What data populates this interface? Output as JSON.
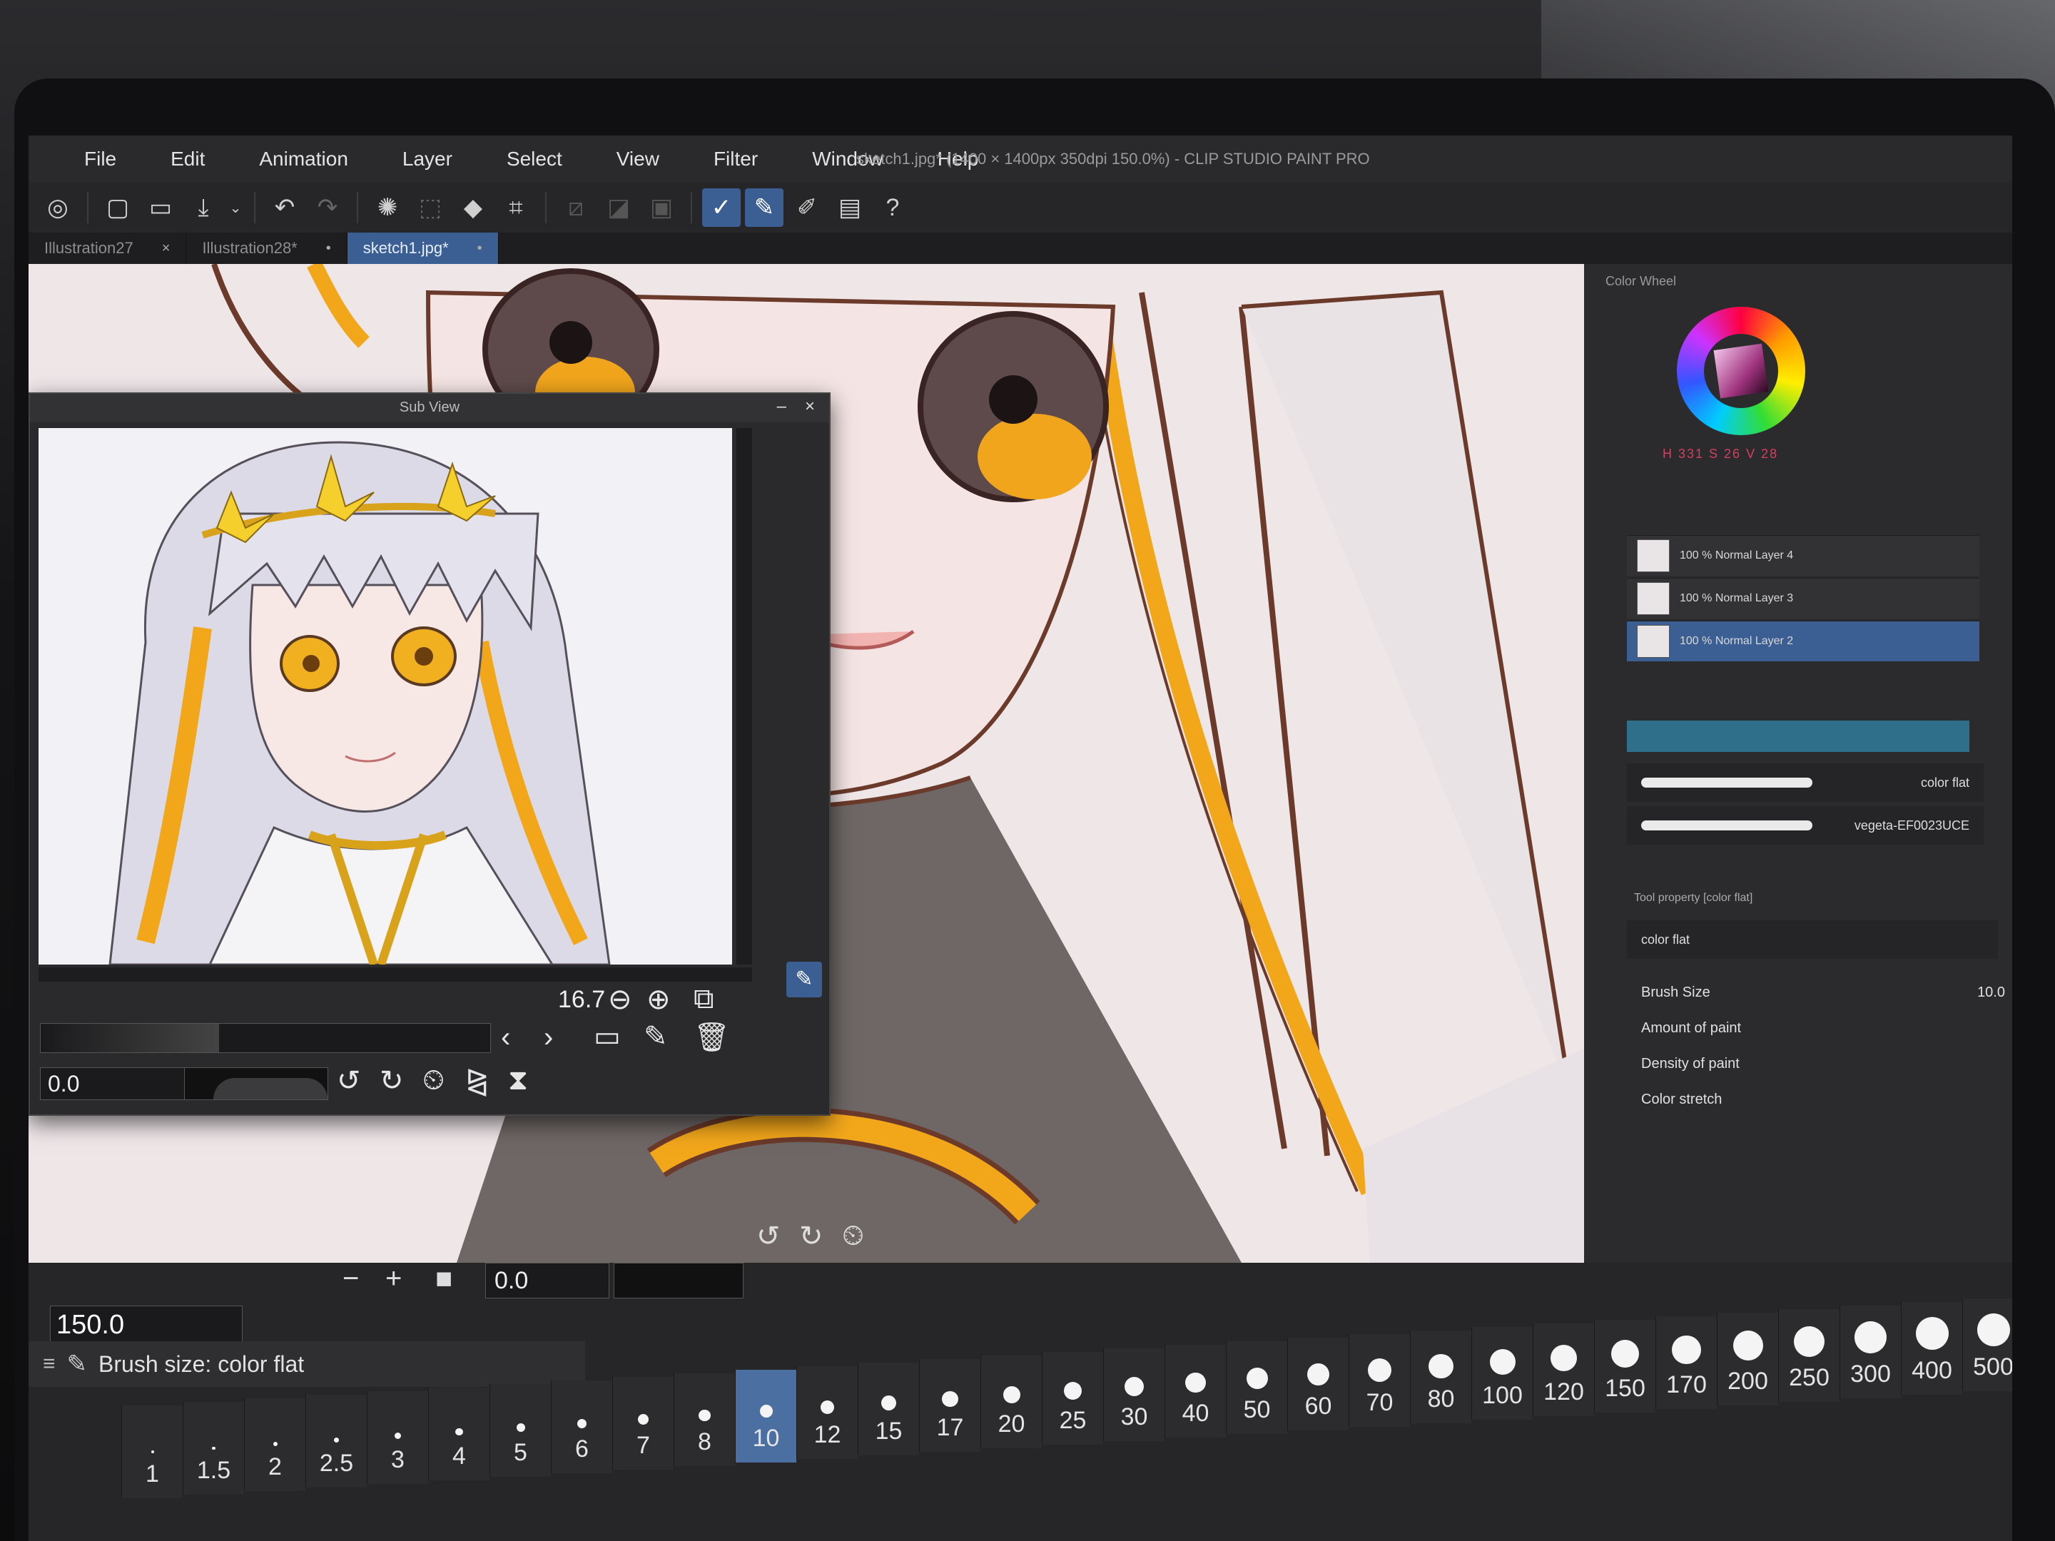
{
  "menu": [
    "File",
    "Edit",
    "Animation",
    "Layer",
    "Select",
    "View",
    "Filter",
    "Window",
    "Help"
  ],
  "document_title": "sketch1.jpg* (1400 × 1400px 350dpi 150.0%) - CLIP STUDIO PAINT PRO",
  "tabs": [
    {
      "label": "Illustration27",
      "close": "×"
    },
    {
      "label": "Illustration28*",
      "close": "•"
    },
    {
      "label": "sketch1.jpg*",
      "close": "•",
      "active": true
    }
  ],
  "toolbar_icons": [
    "clip-logo-icon",
    "new-file-icon",
    "open-folder-icon",
    "save-icon",
    "dropdown-icon",
    "undo-icon",
    "redo-icon",
    "spinner-icon",
    "transform-icon",
    "fill-icon",
    "crop-icon",
    "deselect-icon",
    "ruler-icon",
    "snap-icon",
    "pen-active-icon",
    "pen2-icon",
    "marker-icon",
    "book-icon",
    "help-icon"
  ],
  "right_panel": {
    "title": "Color Wheel",
    "color_values": "H 331  S 26  V 28",
    "layers": [
      {
        "name": "100 % Normal  Layer 4"
      },
      {
        "name": "100 % Normal  Layer 3"
      },
      {
        "name": "100 % Normal  Layer 2",
        "selected": true
      }
    ],
    "brushes": [
      {
        "name": "color flat"
      },
      {
        "name": "vegeta-EF0023UCE"
      }
    ],
    "tool_property_title": "Tool property [color flat]",
    "selected_brush": "color flat",
    "properties": [
      {
        "label": "Brush Size",
        "value": "10.0"
      },
      {
        "label": "Amount of paint",
        "value": ""
      },
      {
        "label": "Density of paint",
        "value": ""
      },
      {
        "label": "Color stretch",
        "value": ""
      }
    ]
  },
  "sub_view": {
    "title": "Sub View",
    "zoom": "16.7",
    "rotation": "0.0"
  },
  "navigator": {
    "rotation": "0.0"
  },
  "brush_size": {
    "title": "Brush size: color flat",
    "current": "150.0",
    "sizes": [
      "1",
      "1.5",
      "2",
      "2.5",
      "3",
      "4",
      "5",
      "6",
      "7",
      "8",
      "10",
      "12",
      "15",
      "17",
      "20",
      "25",
      "30",
      "40",
      "50",
      "60",
      "70",
      "80",
      "100",
      "120",
      "150",
      "170",
      "200",
      "250",
      "300",
      "400",
      "500"
    ],
    "selected": "10"
  },
  "colors": {
    "accent": "#3b5f93",
    "hair_gold": "#f2a71b",
    "canvas_bg": "#ece4e6"
  }
}
